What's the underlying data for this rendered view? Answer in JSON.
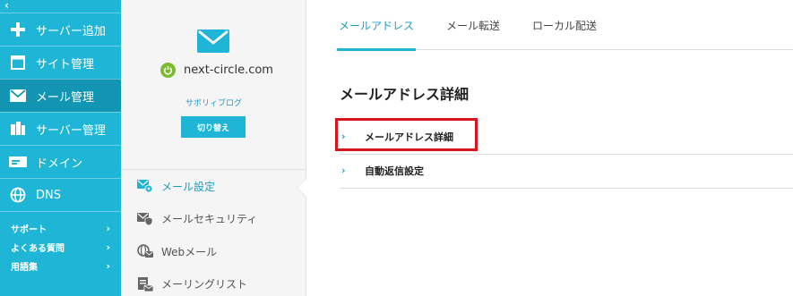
{
  "leftnav": {
    "collapse_glyph": "‹",
    "items": [
      {
        "label": "サーバー追加",
        "icon": "plus-icon"
      },
      {
        "label": "サイト管理",
        "icon": "window-icon"
      },
      {
        "label": "メール管理",
        "icon": "mail-icon",
        "active": true
      },
      {
        "label": "サーバー管理",
        "icon": "server-icon"
      },
      {
        "label": "ドメイン",
        "icon": "domain-card-icon"
      },
      {
        "label": "DNS",
        "icon": "globe-icon"
      }
    ],
    "sub_items": [
      {
        "label": "サポート"
      },
      {
        "label": "よくある質問"
      },
      {
        "label": "用語集"
      }
    ],
    "chevron": "›"
  },
  "account": {
    "domain": "next-circle.com",
    "blog_label": "サボリィブログ",
    "switch_label": "切り替え",
    "status_color": "#7dbb2e"
  },
  "menu": {
    "items": [
      {
        "label": "メール設定",
        "icon": "mail-settings-icon",
        "active": true
      },
      {
        "label": "メールセキュリティ",
        "icon": "mail-security-icon"
      },
      {
        "label": "Webメール",
        "icon": "webmail-icon"
      },
      {
        "label": "メーリングリスト",
        "icon": "mailing-list-icon"
      }
    ]
  },
  "main": {
    "tabs": [
      {
        "label": "メールアドレス",
        "active": true
      },
      {
        "label": "メール転送"
      },
      {
        "label": "ローカル配送"
      }
    ],
    "title": "メールアドレス詳細",
    "rows": [
      {
        "label": "メールアドレス詳細",
        "highlighted": true
      },
      {
        "label": "自動返信設定"
      }
    ],
    "row_chevron": "›"
  },
  "colors": {
    "accent": "#1fb5d6",
    "accent_dark": "#1295b2",
    "link": "#1d9cc0",
    "highlight_border": "#d6161d"
  }
}
